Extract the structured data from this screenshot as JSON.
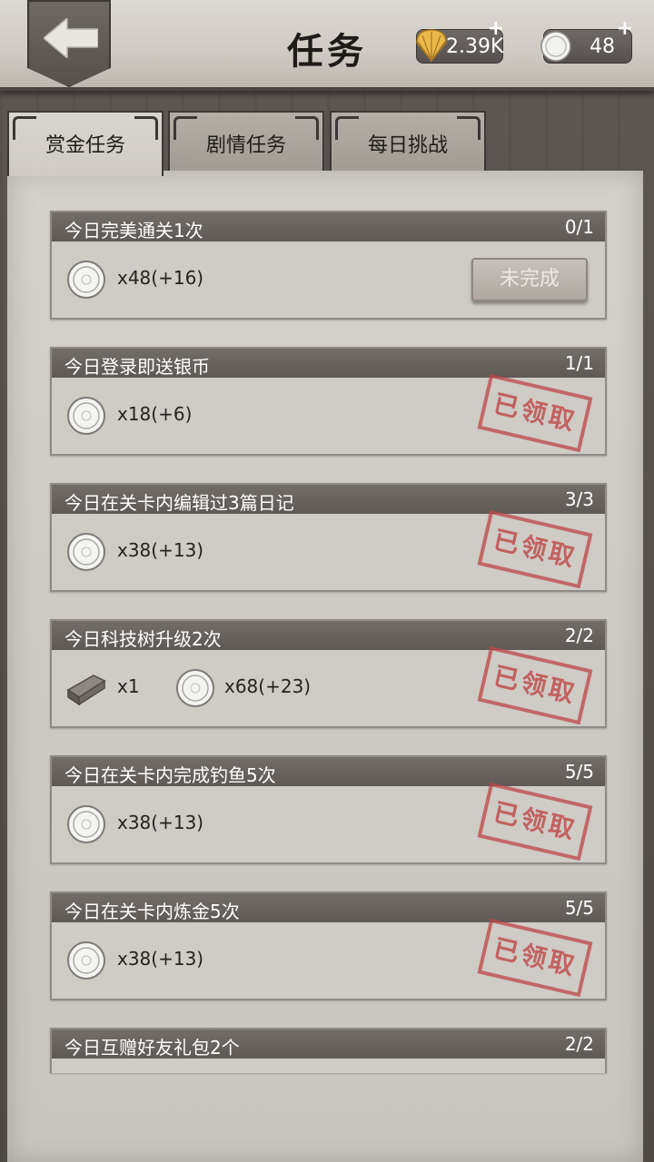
{
  "header": {
    "title": "任务",
    "shells": "2.39K",
    "coins": "48",
    "plus": "+"
  },
  "tabs": [
    {
      "label": "赏金任务",
      "active": true
    },
    {
      "label": "剧情任务",
      "active": false
    },
    {
      "label": "每日挑战",
      "active": false
    }
  ],
  "tasks": [
    {
      "name": "今日完美通关1次",
      "progress": "0/1",
      "reward": "x48(+16)",
      "status": "未完成"
    },
    {
      "name": "今日登录即送银币",
      "progress": "1/1",
      "reward": "x18(+6)",
      "status": "已领取"
    },
    {
      "name": "今日在关卡内编辑过3篇日记",
      "progress": "3/3",
      "reward": "x38(+13)",
      "status": "已领取"
    },
    {
      "name": "今日科技树升级2次",
      "progress": "2/2",
      "reward_item": "x1",
      "reward": "x68(+23)",
      "status": "已领取"
    },
    {
      "name": "今日在关卡内完成钓鱼5次",
      "progress": "5/5",
      "reward": "x38(+13)",
      "status": "已领取"
    },
    {
      "name": "今日在关卡内炼金5次",
      "progress": "5/5",
      "reward": "x38(+13)",
      "status": "已领取"
    },
    {
      "name": "今日互赠好友礼包2个",
      "progress": "2/2"
    }
  ],
  "colors": {
    "header_bar": "#685f5b",
    "stamp_red": "#be4646",
    "parchment": "#d0ccc6"
  },
  "icons": {
    "back": "back-arrow-icon",
    "shell": "shell-icon",
    "coin": "silver-coin-icon",
    "plank": "wood-plank-icon"
  }
}
